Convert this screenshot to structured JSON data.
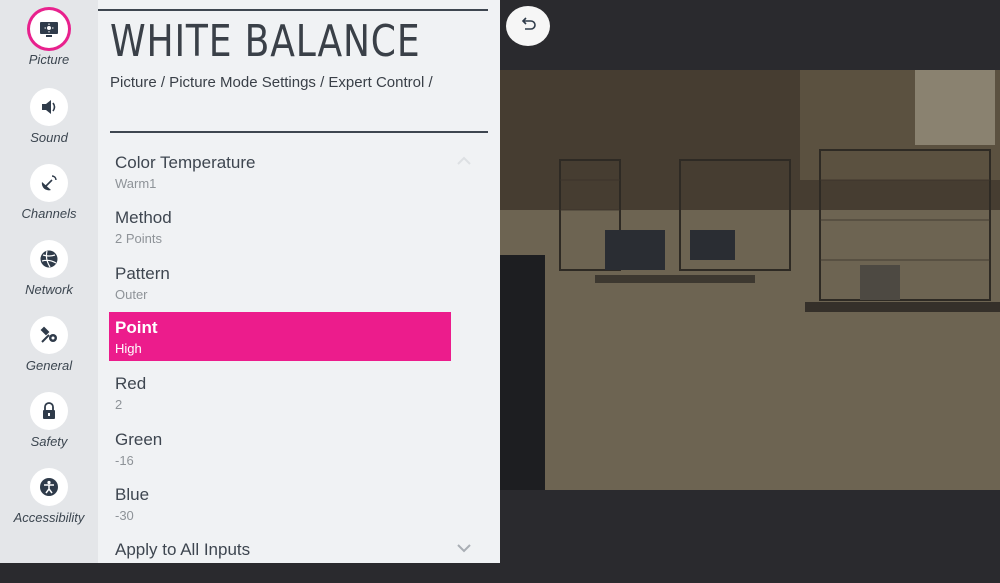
{
  "sidebar": {
    "items": [
      {
        "label": "Picture",
        "icon": "picture-icon"
      },
      {
        "label": "Sound",
        "icon": "sound-icon"
      },
      {
        "label": "Channels",
        "icon": "channels-icon"
      },
      {
        "label": "Network",
        "icon": "network-icon"
      },
      {
        "label": "General",
        "icon": "general-icon"
      },
      {
        "label": "Safety",
        "icon": "safety-icon"
      },
      {
        "label": "Accessibility",
        "icon": "accessibility-icon"
      }
    ],
    "active": "Picture"
  },
  "header": {
    "title": "WHITE BALANCE",
    "breadcrumb": "Picture / Picture Mode Settings / Expert Control /"
  },
  "menu": {
    "items": [
      {
        "label": "Color Temperature",
        "value": "Warm1"
      },
      {
        "label": "Method",
        "value": "2 Points"
      },
      {
        "label": "Pattern",
        "value": "Outer"
      },
      {
        "label": "Point",
        "value": "High",
        "selected": true
      },
      {
        "label": "Red",
        "value": "2"
      },
      {
        "label": "Green",
        "value": "-16"
      },
      {
        "label": "Blue",
        "value": "-30"
      },
      {
        "label": "Apply to All Inputs",
        "value": ""
      }
    ]
  },
  "colors": {
    "accent": "#ec1c8c",
    "panel_bg": "#f0f2f4",
    "rail_bg": "#e4e6e9",
    "text": "#3e4650"
  },
  "preview": {
    "back_icon": "back-arrow-icon"
  }
}
